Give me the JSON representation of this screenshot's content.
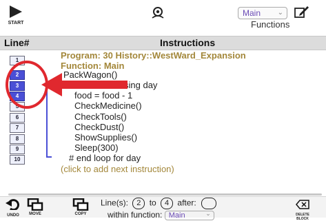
{
  "toolbar": {
    "start_label": "START",
    "function_select": "Main",
    "functions_label": "Functions"
  },
  "header": {
    "line_col": "Line#",
    "instructions_col": "Instructions"
  },
  "program": {
    "program_line": "Program: 30 History::WestWard_Expansion",
    "function_line": "Function: Main"
  },
  "lines": [
    {
      "num": "1",
      "text": "",
      "selected": false
    },
    {
      "num": "2",
      "text": "PackWagon()",
      "selected": true
    },
    {
      "num": "3",
      "text": "sing day",
      "selected": true
    },
    {
      "num": "4",
      "text": "food = food - 1",
      "selected": true
    },
    {
      "num": "5",
      "text": "CheckMedicine()",
      "selected": false
    },
    {
      "num": "6",
      "text": "CheckTools()",
      "selected": false
    },
    {
      "num": "7",
      "text": "CheckDust()",
      "selected": false
    },
    {
      "num": "8",
      "text": "ShowSupplies()",
      "selected": false
    },
    {
      "num": "9",
      "text": "Sleep(300)",
      "selected": false
    },
    {
      "num": "10",
      "text": "# end loop for day",
      "selected": false
    }
  ],
  "add_hint": "(click to add next instruction)",
  "bottom": {
    "undo": "UNDO",
    "move": "MOVE",
    "copy": "COPY",
    "lines_label": "Line(s):",
    "from": "2",
    "to_label": "to",
    "to": "4",
    "after_label": "after:",
    "within_label": "within function:",
    "within_value": "Main",
    "delete_line1": "DELETE",
    "delete_line2": "BLOCK"
  },
  "colors": {
    "accent": "#4a4fd6",
    "program_text": "#a3873a",
    "annotation": "#e0282e"
  }
}
